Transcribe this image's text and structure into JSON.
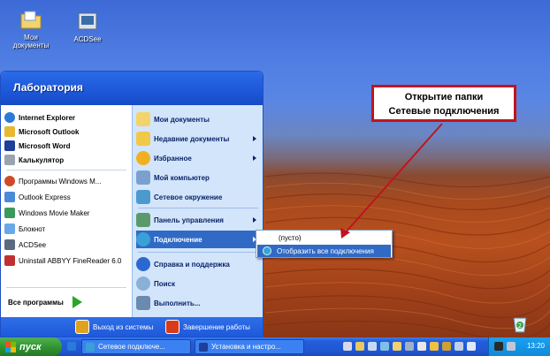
{
  "desktop": {
    "icons": [
      {
        "label": "Мои документы"
      },
      {
        "label": "ACDSee"
      }
    ]
  },
  "annotation": {
    "line1": "Открытие папки",
    "line2": "Сетевые подключения"
  },
  "start_menu": {
    "user": "Лаборатория",
    "pinned": [
      {
        "label": "Internet Explorer"
      },
      {
        "label": "Microsoft Outlook"
      },
      {
        "label": "Microsoft Word"
      },
      {
        "label": "Калькулятор"
      }
    ],
    "recent": [
      {
        "label": "Программы Windows M..."
      },
      {
        "label": "Outlook Express"
      },
      {
        "label": "Windows Movie Maker"
      },
      {
        "label": "Блокнот"
      },
      {
        "label": "ACDSee"
      },
      {
        "label": "Uninstall ABBYY FineReader 6.0"
      }
    ],
    "all_programs": "Все программы",
    "places": [
      {
        "label": "Мои документы"
      },
      {
        "label": "Недавние документы"
      },
      {
        "label": "Избранное"
      },
      {
        "label": "Мой компьютер"
      },
      {
        "label": "Сетевое окружение"
      },
      {
        "label": "Панель управления"
      },
      {
        "label": "Подключение"
      },
      {
        "label": "Справка и поддержка"
      },
      {
        "label": "Поиск"
      },
      {
        "label": "Выполнить..."
      }
    ],
    "logoff": "Выход из системы",
    "shutdown": "Завершение работы"
  },
  "submenu": {
    "items": [
      {
        "label": "(пусто)"
      },
      {
        "label": "Отобразить все подключения"
      }
    ]
  },
  "taskbar": {
    "start_label": "пуск",
    "tasks": [
      {
        "label": "Сетевое подключе..."
      },
      {
        "label": "Установка и настро..."
      }
    ],
    "tray_badge": "2",
    "clock": "13:20"
  },
  "colors": {
    "menu_blue": "#1c57d8",
    "highlight": "#316ac5",
    "callout_border": "#c0141e",
    "start_green": "#2f8f2f"
  }
}
